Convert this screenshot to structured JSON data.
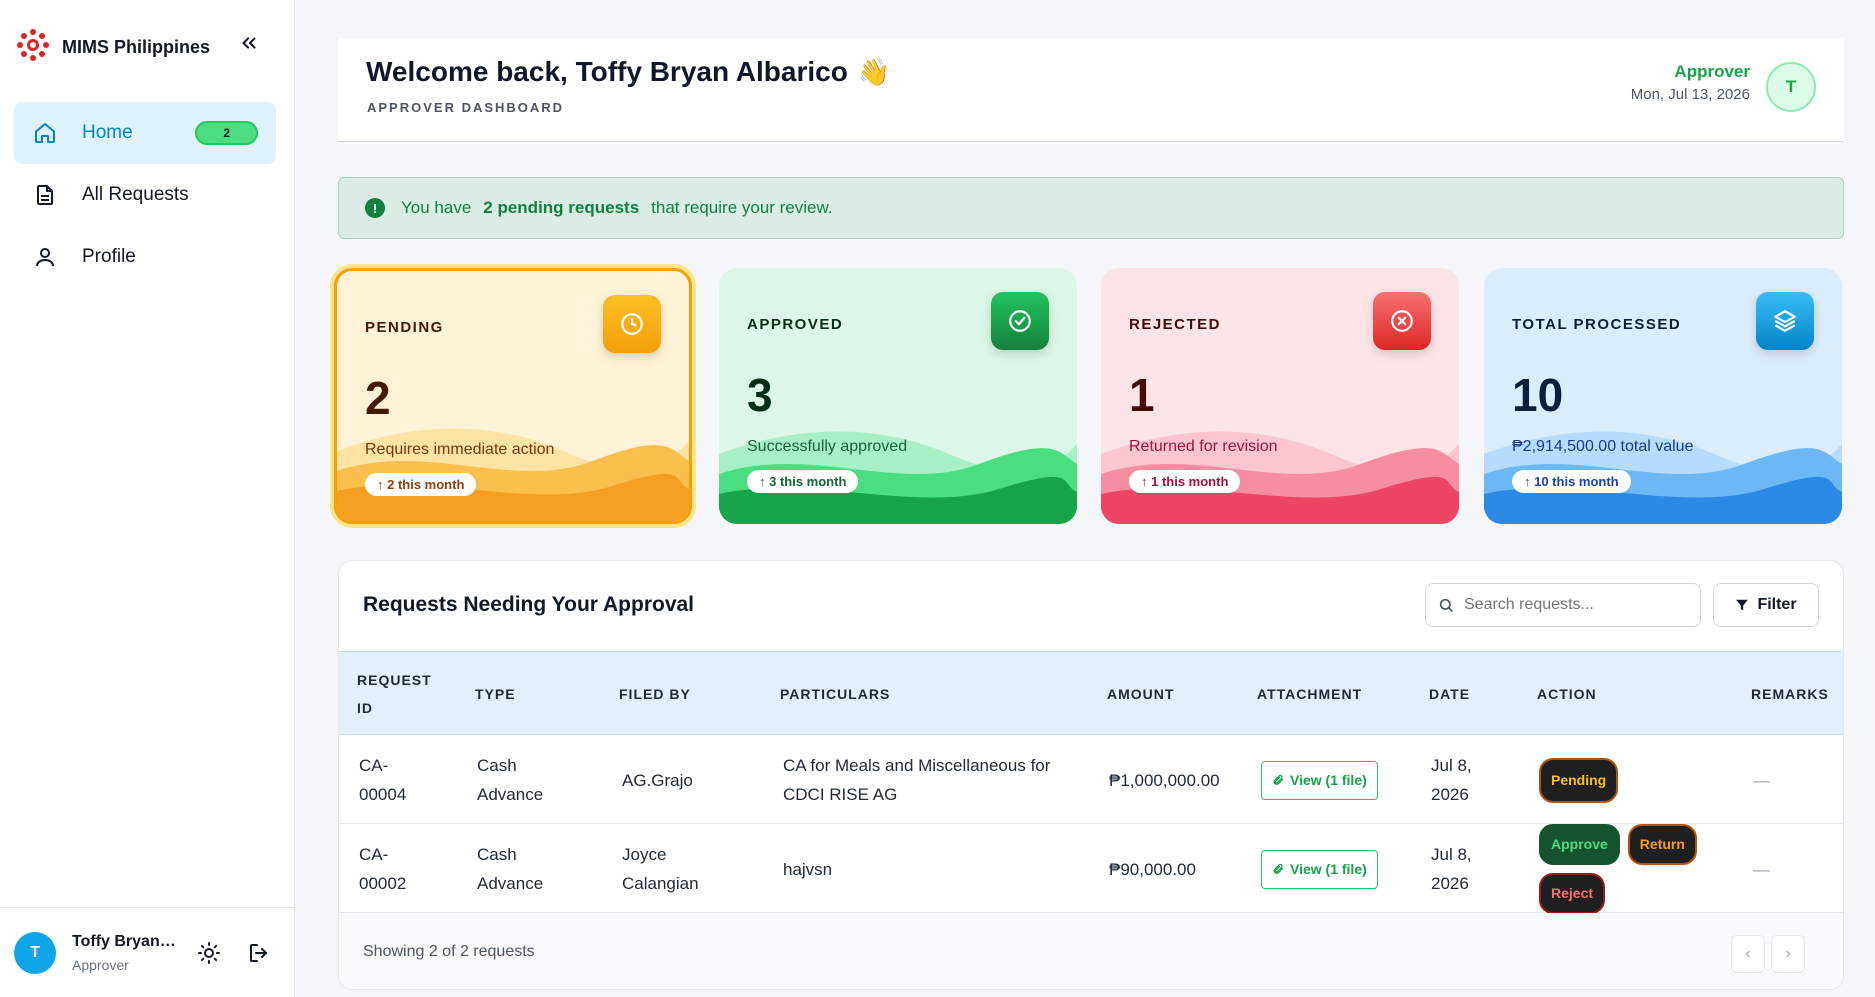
{
  "sidebar": {
    "brand": "MIMS Philippines",
    "items": [
      {
        "label": "Home",
        "badge": "2"
      },
      {
        "label": "All Requests"
      },
      {
        "label": "Profile"
      }
    ],
    "user": {
      "initial": "T",
      "name": "Toffy Bryan Albarico",
      "role": "Approver"
    }
  },
  "header": {
    "welcome": "Welcome back, Toffy Bryan Albarico",
    "emoji": "👋",
    "subtitle": "APPROVER DASHBOARD",
    "role": "Approver",
    "date": "Mon, Jul 13, 2026",
    "initial": "T"
  },
  "alert": {
    "prefix": "You have",
    "highlight": "2 pending requests",
    "suffix": "that require your review.",
    "icon": "!"
  },
  "cards": {
    "pending": {
      "label": "PENDING",
      "value": "2",
      "desc": "Requires immediate action",
      "trend": "↑ 2 this month",
      "color": "#f59e0b"
    },
    "approved": {
      "label": "APPROVED",
      "value": "3",
      "desc": "Successfully approved",
      "trend": "↑ 3 this month",
      "color": "#16a34a"
    },
    "rejected": {
      "label": "REJECTED",
      "value": "1",
      "desc": "Returned for revision",
      "trend": "↑ 1 this month",
      "color": "#ef4444"
    },
    "total": {
      "label": "TOTAL PROCESSED",
      "value": "10",
      "desc": "₱2,914,500.00 total value",
      "trend": "↑ 10 this month",
      "color": "#0ea5e9"
    }
  },
  "table": {
    "title": "Requests Needing Your Approval",
    "search_placeholder": "Search requests...",
    "filter_label": "Filter",
    "columns": [
      "REQUEST ID",
      "TYPE",
      "FILED BY",
      "PARTICULARS",
      "AMOUNT",
      "ATTACHMENT",
      "DATE",
      "ACTION",
      "REMARKS"
    ],
    "rows": [
      {
        "id": "CA-00004",
        "type": "Cash Advance",
        "filed_by": "AG.Grajo",
        "particulars": "CA for Meals and Miscellaneous for CDCI RISE AG",
        "amount": "₱1,000,000.00",
        "attachment": "View (1 file)",
        "date": "Jul 8, 2026",
        "status": "Pending",
        "remarks": "—"
      },
      {
        "id": "CA-00002",
        "type": "Cash Advance",
        "filed_by": "Joyce Calangian",
        "particulars": "hajvsn",
        "amount": "₱90,000.00",
        "attachment": "View (1 file)",
        "date": "Jul 8, 2026",
        "actions": [
          "Approve",
          "Return",
          "Reject"
        ],
        "remarks": "—"
      }
    ],
    "footer": "Showing 2 of 2 requests",
    "prev": "‹",
    "next": "›"
  }
}
